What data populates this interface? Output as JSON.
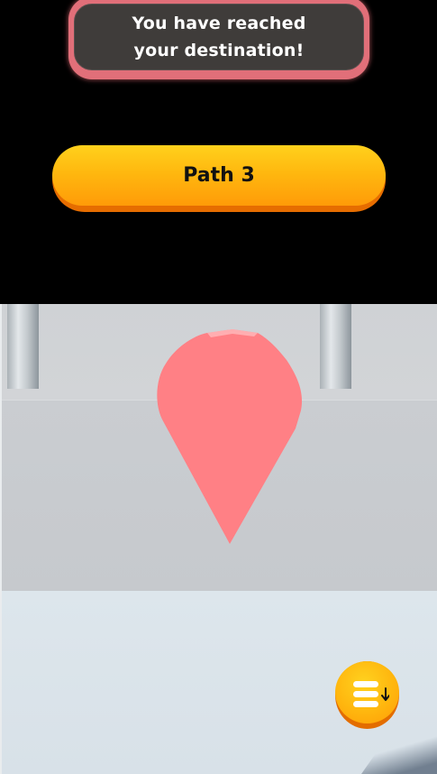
{
  "notice": {
    "message": "You have reached your destination!"
  },
  "path_button": {
    "label": "Path 3"
  },
  "menu_button": {
    "icon": "menu-download-icon"
  },
  "scene": {
    "marker_icon": "location-pin-icon",
    "colors": {
      "pin": "#ff8085",
      "button_yellow": "#ffb80f",
      "button_shadow": "#e66d00",
      "notice_border": "#e16f79",
      "notice_fill": "#3f3c3a"
    }
  }
}
